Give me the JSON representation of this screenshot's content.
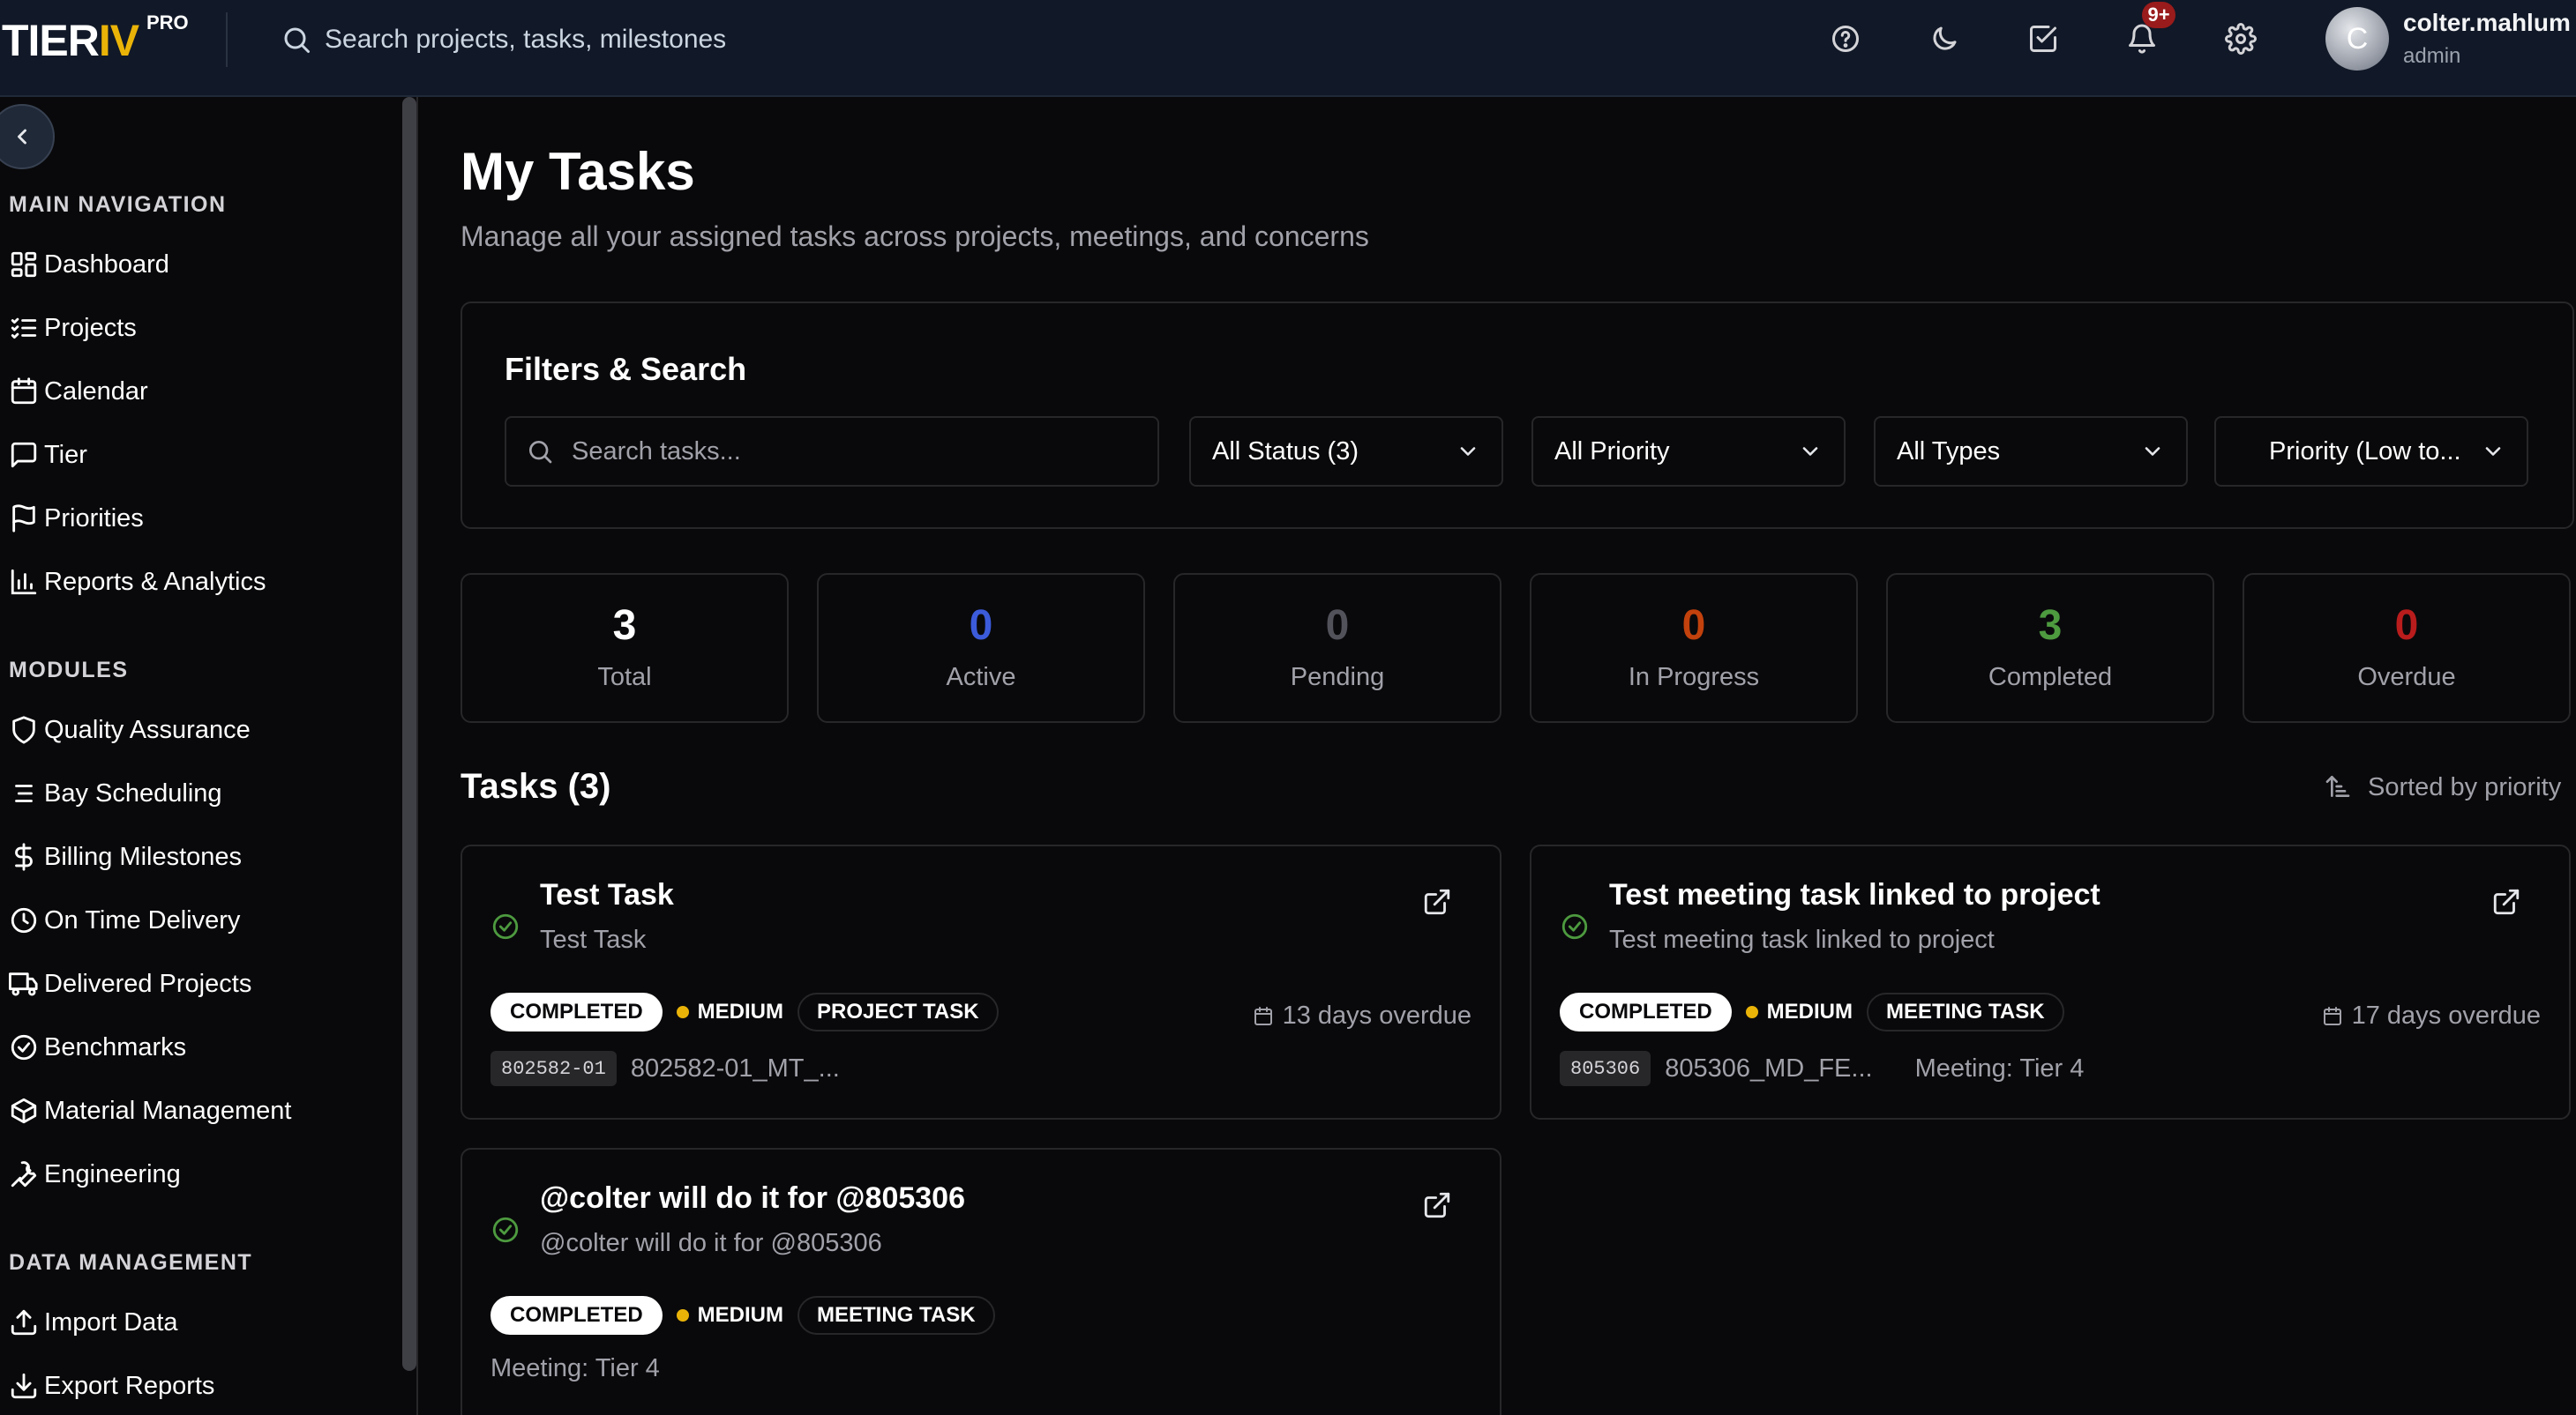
{
  "app": {
    "logo_tier": "TIER",
    "logo_iv": "IV",
    "logo_pro": "PRO"
  },
  "topbar": {
    "search_placeholder": "Search projects, tasks, milestones",
    "icons": [
      "help-icon",
      "moon-icon",
      "tasks-check-icon",
      "bell-icon",
      "gear-icon"
    ],
    "notification_badge": "9+",
    "avatar_initial": "C",
    "user_name": "colter.mahlum",
    "user_role": "admin"
  },
  "sidebar": {
    "main_nav_label": "MAIN NAVIGATION",
    "main_nav": [
      {
        "label": "Dashboard",
        "icon": "dashboard-icon"
      },
      {
        "label": "Projects",
        "icon": "list-checks-icon"
      },
      {
        "label": "Calendar",
        "icon": "calendar-icon"
      },
      {
        "label": "Tier",
        "icon": "message-square-icon"
      },
      {
        "label": "Priorities",
        "icon": "flag-icon"
      },
      {
        "label": "Reports & Analytics",
        "icon": "bar-chart-icon"
      }
    ],
    "modules_label": "MODULES",
    "modules": [
      {
        "label": "Quality Assurance",
        "icon": "shield-icon"
      },
      {
        "label": "Bay Scheduling",
        "icon": "list-icon"
      },
      {
        "label": "Billing Milestones",
        "icon": "dollar-icon"
      },
      {
        "label": "On Time Delivery",
        "icon": "clock-icon"
      },
      {
        "label": "Delivered Projects",
        "icon": "truck-icon"
      },
      {
        "label": "Benchmarks",
        "icon": "check-circle-icon"
      },
      {
        "label": "Material Management",
        "icon": "package-icon"
      },
      {
        "label": "Engineering",
        "icon": "wrench-icon"
      }
    ],
    "data_label": "DATA MANAGEMENT",
    "data": [
      {
        "label": "Import Data",
        "icon": "upload-icon"
      },
      {
        "label": "Export Reports",
        "icon": "download-icon"
      }
    ]
  },
  "main": {
    "title": "My Tasks",
    "subtitle": "Manage all your assigned tasks across projects, meetings, and concerns"
  },
  "filters": {
    "title": "Filters & Search",
    "search_placeholder": "Search tasks...",
    "status": "All Status (3)",
    "priority": "All Priority",
    "type": "All Types",
    "sort": "Priority (Low to..."
  },
  "stats": [
    {
      "value": "3",
      "label": "Total",
      "color": "#ffffff"
    },
    {
      "value": "0",
      "label": "Active",
      "color": "#3b5bdb"
    },
    {
      "value": "0",
      "label": "Pending",
      "color": "#52525b"
    },
    {
      "value": "0",
      "label": "In Progress",
      "color": "#c2410c"
    },
    {
      "value": "3",
      "label": "Completed",
      "color": "#4d9a3f"
    },
    {
      "value": "0",
      "label": "Overdue",
      "color": "#b91c1c"
    }
  ],
  "tasks_header": {
    "title": "Tasks (3)",
    "sorted": "Sorted by priority"
  },
  "tasks": [
    {
      "title": "Test Task",
      "description": "Test Task",
      "status": "COMPLETED",
      "priority": "MEDIUM",
      "type": "PROJECT TASK",
      "overdue": "13 days overdue",
      "code": "802582-01",
      "project": "802582-01_MT_...",
      "meeting": ""
    },
    {
      "title": "Test meeting task linked to project",
      "description": "Test meeting task linked to project",
      "status": "COMPLETED",
      "priority": "MEDIUM",
      "type": "MEETING TASK",
      "overdue": "17 days overdue",
      "code": "805306",
      "project": "805306_MD_FE...",
      "meeting": "Meeting: Tier 4"
    },
    {
      "title": "@colter will do it for @805306",
      "description": "@colter will do it for @805306",
      "status": "COMPLETED",
      "priority": "MEDIUM",
      "type": "MEETING TASK",
      "overdue": "",
      "code": "",
      "project": "",
      "meeting": "Meeting: Tier 4"
    }
  ],
  "colors": {
    "accent_yellow": "#eab308",
    "success_green": "#4d9a3f",
    "background": "#09090b",
    "topbar": "#111827"
  }
}
